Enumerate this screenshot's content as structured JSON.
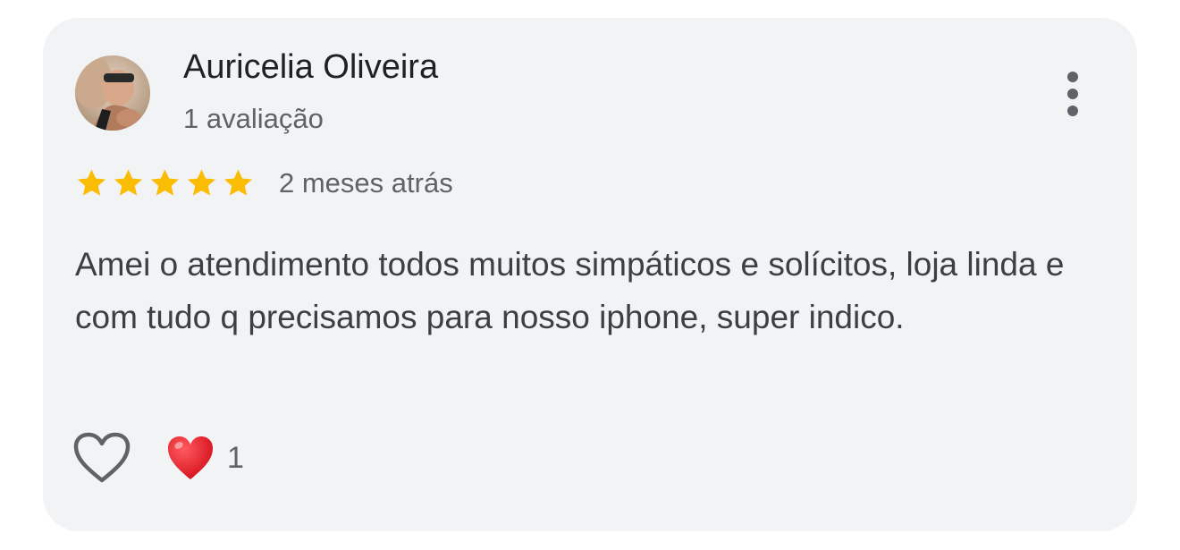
{
  "review": {
    "author_name": "Auricelia Oliveira",
    "author_reviews": "1 avaliação",
    "rating": 5,
    "rating_max": 5,
    "time_ago": "2 meses atrás",
    "text": "Amei o atendimento todos muitos simpáticos e solícitos, loja linda e com tudo q precisamos para nosso iphone, super indico.",
    "reactions": {
      "heart_count": "1"
    }
  },
  "icons": {
    "avatar": "profile-photo",
    "more": "more-vert-icon",
    "star": "star-icon",
    "like": "heart-outline-icon",
    "reaction": "red-heart-emoji"
  },
  "colors": {
    "card_background": "#f1f3f4",
    "star": "#fbbc04",
    "heart": "#e8141e",
    "primary_text": "#202124",
    "secondary_text": "#5f6368"
  }
}
